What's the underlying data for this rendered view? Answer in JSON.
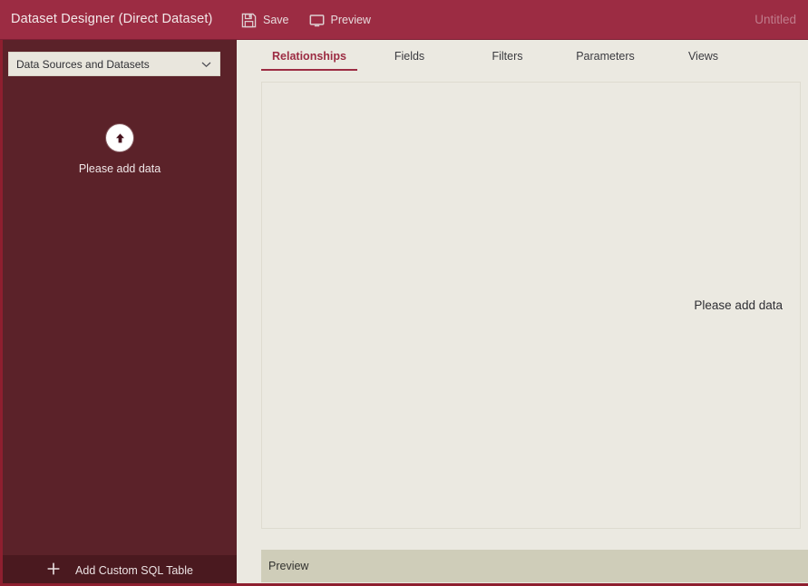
{
  "titlebar": {
    "app_title": "Dataset Designer (Direct Dataset)",
    "window_name": "Untitled",
    "buttons": [
      {
        "label": "Save",
        "icon": "save-floppy-icon"
      },
      {
        "label": "Preview",
        "icon": "monitor-preview-icon"
      }
    ]
  },
  "sidebar": {
    "source_select": {
      "value": "Data Sources and Datasets",
      "icon": "chevron-down-icon"
    },
    "empty_state": {
      "icon": "upload-arrow-icon",
      "message": "Please add data"
    },
    "add_sql_button": {
      "label": "Add Custom SQL Table",
      "icon": "plus-icon"
    }
  },
  "main": {
    "tabs": [
      {
        "label": "Relationships",
        "active": true
      },
      {
        "label": "Fields",
        "active": false
      },
      {
        "label": "Filters",
        "active": false
      },
      {
        "label": "Parameters",
        "active": false
      },
      {
        "label": "Views",
        "active": false
      }
    ],
    "canvas": {
      "message": "Please add data"
    },
    "preview_panel": {
      "label": "Preview"
    }
  },
  "colors": {
    "titlebar": "#9c2c43",
    "sidebar": "#5b2229",
    "sidebar_footer": "#4a191f",
    "canvas": "#ebe9e1",
    "preview_bar": "#cfcdb9",
    "accent": "#9c2c43",
    "window_name": "#c07c8c"
  }
}
